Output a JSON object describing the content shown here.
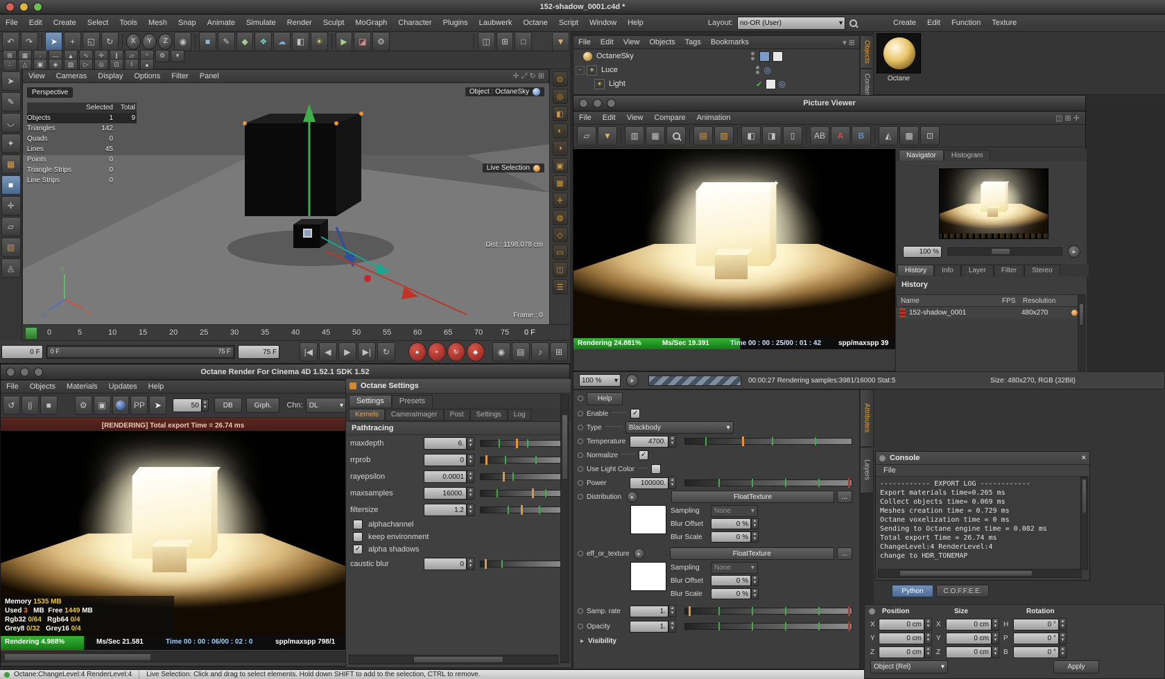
{
  "colors": {
    "accent_orange": "#e8943a",
    "progress_green": "#27a327",
    "record_red": "#b5342c",
    "selection_blue": "#5d83ad",
    "status_green": "#35a035"
  },
  "window": {
    "title": "152-shadow_0001.c4d *"
  },
  "menubar": {
    "items": [
      "File",
      "Edit",
      "Create",
      "Select",
      "Tools",
      "Mesh",
      "Snap",
      "Animate",
      "Simulate",
      "Render",
      "Sculpt",
      "MoGraph",
      "Character",
      "Plugins",
      "Laubwerk",
      "Octane",
      "Script",
      "Window",
      "Help"
    ],
    "layout_label": "Layout:",
    "layout_value": "no-OR (User)"
  },
  "right_menubar": {
    "items": [
      "Create",
      "Edit",
      "Function",
      "Texture"
    ]
  },
  "material_dock": {
    "material_name": "Octane"
  },
  "dock_tabs": {
    "objects": "Objects",
    "content": "Content"
  },
  "side_tabs": {
    "attributes": "Attributes",
    "layers": "Layers"
  },
  "viewport": {
    "menus": [
      "View",
      "Cameras",
      "Display",
      "Options",
      "Filter",
      "Panel"
    ],
    "camera": "Perspective",
    "stats": {
      "col_selected": "Selected",
      "col_total": "Total",
      "rows": [
        {
          "label": "Objects",
          "selected": "1",
          "total": "9"
        },
        {
          "label": "Triangles",
          "selected": "142",
          "total": ""
        },
        {
          "label": "Quads",
          "selected": "0",
          "total": ""
        },
        {
          "label": "Lines",
          "selected": "45",
          "total": ""
        },
        {
          "label": "Points",
          "selected": "0",
          "total": ""
        },
        {
          "label": "Triangle Strips",
          "selected": "0",
          "total": ""
        },
        {
          "label": "Line Strips",
          "selected": "0",
          "total": ""
        }
      ]
    },
    "object_badge": "Object : OctaneSky",
    "tool_badge": "Live Selection",
    "dist_badge": "Dist : 1198.078 cm",
    "frame_badge": "Frame : 0"
  },
  "timeline": {
    "ticks": [
      "0",
      "5",
      "10",
      "15",
      "20",
      "25",
      "30",
      "35",
      "40",
      "45",
      "50",
      "55",
      "60",
      "65",
      "70",
      "75"
    ],
    "current": "0 F",
    "current_field": "0 F",
    "range_start": "0 F",
    "range_end": "75 F",
    "end_field": "75 F"
  },
  "object_manager": {
    "menus": [
      "File",
      "Edit",
      "View",
      "Objects",
      "Tags",
      "Bookmarks"
    ],
    "objects": [
      {
        "name": "OctaneSky"
      },
      {
        "name": "Luce"
      },
      {
        "name": "Light"
      }
    ]
  },
  "picture_viewer": {
    "title": "Picture Viewer",
    "menus": [
      "File",
      "Edit",
      "View",
      "Compare",
      "Animation"
    ],
    "nav_tabs": [
      "Navigator",
      "Histogram"
    ],
    "zoom_value": "100 %",
    "panel_tabs": [
      "History",
      "Info",
      "Layer",
      "Filter",
      "Stereo"
    ],
    "history_title": "History",
    "columns": [
      "Name",
      "FPS",
      "Resolution"
    ],
    "rows": [
      {
        "name": "152-shadow_0001",
        "resolution": "480x270"
      }
    ],
    "status": {
      "rendering": "Rendering",
      "percent": "24.881%",
      "mssec_label": "Ms/Sec",
      "mssec": "19.391",
      "time_label": "Time",
      "time": "00 : 00 : 25/00 : 01 : 42",
      "spp_label": "spp/maxspp",
      "spp": "39"
    },
    "bottom": {
      "zoom": "100 %",
      "samples": "00:00:27 Rendering samples:3981/16000 Stat:5",
      "size": "Size: 480x270, RGB (32Bit)"
    }
  },
  "octane_render": {
    "title": "Octane Render For Cinema 4D 1.52.1   SDK 1.52",
    "menus": [
      "File",
      "Objects",
      "Materials",
      "Updates",
      "Help"
    ],
    "toolbar": {
      "pp": "PP",
      "samples": "50",
      "db": "DB",
      "graph": "Grph.",
      "channel_label": "Chn:",
      "channel": "DL"
    },
    "export_banner": "[RENDERING] Total export Time = 26.74 ms",
    "stats": {
      "memory_label": "Memory",
      "memory": "1535 MB",
      "used_label": "Used",
      "used": "3",
      "used_unit": "MB",
      "free_label": "Free",
      "free": "1449",
      "free_unit": "MB",
      "rgb32_label": "Rgb32",
      "rgb32": "0/64",
      "rgb64_label": "Rgb64",
      "rgb64": "0/4",
      "grey8_label": "Grey8",
      "grey8": "0/32",
      "grey16_label": "Grey16",
      "grey16": "0/4"
    },
    "status": {
      "rendering": "Rendering",
      "percent": "4.988%",
      "mssec_label": "Ms/Sec",
      "mssec": "21.581",
      "time_label": "Time",
      "time": "00 : 00 : 06/00 : 02 : 0",
      "spp_label": "spp/maxspp",
      "spp": "798/1"
    }
  },
  "octane_settings": {
    "title": "Octane Settings",
    "tabs": [
      "Settings",
      "Presets"
    ],
    "subtabs": [
      "Kernels",
      "CameraImager",
      "Post",
      "Settings",
      "Log"
    ],
    "section": "Pathtracing",
    "fields": [
      {
        "label": "maxdepth",
        "value": "6."
      },
      {
        "label": "rrprob",
        "value": "0"
      },
      {
        "label": "rayepsilon",
        "value": "0.0001"
      },
      {
        "label": "maxsamples",
        "value": "16000."
      },
      {
        "label": "filtersize",
        "value": "1.2"
      }
    ],
    "checks": [
      {
        "label": "alphachannel"
      },
      {
        "label": "keep environment"
      },
      {
        "label": "alpha shadows"
      }
    ],
    "caustic_label": "caustic blur",
    "caustic_value": "0"
  },
  "light": {
    "help": "Help",
    "enable": "Enable",
    "type_label": "Type",
    "type_value": "Blackbody",
    "temperature_label": "Temperature",
    "temperature": "4700.",
    "normalize": "Normalize",
    "use_light_color": "Use Light Color",
    "power_label": "Power",
    "power": "100000.",
    "distribution_label": "Distribution",
    "distribution_btn": "FloatTexture",
    "more": "...",
    "sampling_label": "Sampling",
    "sampling": "None",
    "blur_offset_label": "Blur Offset",
    "blur_offset": "0 %",
    "blur_scale_label": "Blur Scale",
    "blur_scale": "0 %",
    "eff_label": "eff_or_texture",
    "eff_btn": "FloatTexture",
    "sampling2": "None",
    "blur_offset2": "0 %",
    "blur_scale2": "0 %",
    "samp_rate_label": "Samp. rate",
    "samp_rate": "1.",
    "opacity_label": "Opacity",
    "opacity": "1.",
    "visibility": "Visibility"
  },
  "console": {
    "title": "Console",
    "menu": "File",
    "lines": [
      "------------ EXPORT LOG ------------",
      "Export materials time=0.265 ms",
      "Collect objects time= 0.069 ms",
      "Meshes creation time = 0.729 ms",
      "Octane voxelization time = 0 ms",
      "Sending to Octane engine time = 0.082 ms",
      "Total export Time = 26.74 ms",
      "ChangeLevel:4 RenderLevel:4",
      "change to HDR_TONEMAP"
    ]
  },
  "script_tabs": {
    "python": "Python",
    "coffee": "C.O.F.F.E.E."
  },
  "coordinates": {
    "headers": [
      "Position",
      "Size",
      "Rotation"
    ],
    "position": [
      {
        "axis": "X",
        "value": "0 cm"
      },
      {
        "axis": "Y",
        "value": "0 cm"
      },
      {
        "axis": "Z",
        "value": "0 cm"
      }
    ],
    "size": [
      {
        "axis": "X",
        "value": "0 cm"
      },
      {
        "axis": "Y",
        "value": "0 cm"
      },
      {
        "axis": "Z",
        "value": "0 cm"
      }
    ],
    "rotation": [
      {
        "axis": "H",
        "value": "0 °"
      },
      {
        "axis": "P",
        "value": "0 °"
      },
      {
        "axis": "B",
        "value": "0 °"
      }
    ],
    "mode": "Object (Rel)",
    "apply": "Apply"
  },
  "statusbar": {
    "left": "Octane:ChangeLevel:4 RenderLevel:4",
    "right": "Live Selection: Click and drag to select elements. Hold down SHIFT to add to the selection, CTRL to remove."
  }
}
